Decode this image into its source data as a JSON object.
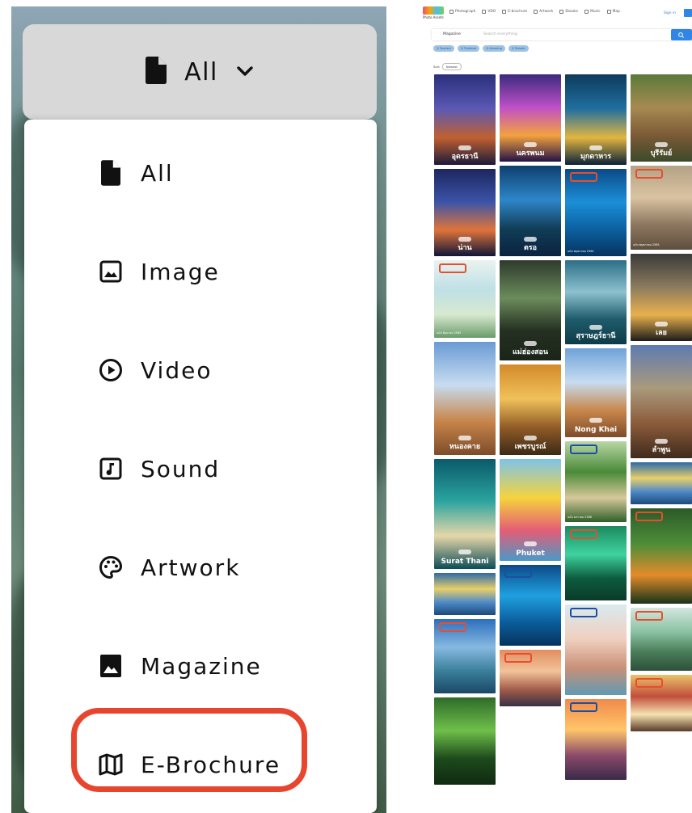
{
  "dropdown": {
    "selected_label": "All",
    "items": [
      {
        "label": "All",
        "icon": "file-icon"
      },
      {
        "label": "Image",
        "icon": "image-icon"
      },
      {
        "label": "Video",
        "icon": "play-circle-icon"
      },
      {
        "label": "Sound",
        "icon": "music-note-icon"
      },
      {
        "label": "Artwork",
        "icon": "palette-icon"
      },
      {
        "label": "Magazine",
        "icon": "bookmark-image-icon"
      },
      {
        "label": "E-Brochure",
        "icon": "map-icon"
      }
    ],
    "highlighted_item": "E-Brochure",
    "highlight_color": "#e8452f"
  },
  "site": {
    "logo_caption": "Photo Assets",
    "nav": [
      "Photograph",
      "VDO",
      "E-brochure",
      "Artwork",
      "Ebooks",
      "Music",
      "Map"
    ],
    "sign_in": "Sign in",
    "search": {
      "type_select": "Magazine",
      "placeholder": "Search everything"
    },
    "chips": [
      "Q Tourism",
      "Q Thailand",
      "Q Amazing",
      "Q Temple"
    ],
    "sort": {
      "label": "Sort",
      "value": "Newest"
    },
    "cards": [
      {
        "col": 0,
        "title": "อุดรธานี",
        "kind": "amazing",
        "colors": [
          "#2a2f7a",
          "#5b59b5",
          "#c06030",
          "#1b1a3a"
        ]
      },
      {
        "col": 1,
        "title": "นครพนม",
        "kind": "amazing",
        "colors": [
          "#3b2b7e",
          "#c050c8",
          "#f3a23e",
          "#231246"
        ]
      },
      {
        "col": 2,
        "title": "มุกดาหาร",
        "kind": "amazing",
        "colors": [
          "#0e3a5a",
          "#1f6fa0",
          "#e1b540",
          "#0a2239"
        ]
      },
      {
        "col": 3,
        "title": "บุรีรัมย์",
        "kind": "amazing",
        "colors": [
          "#5a7a3a",
          "#a68a52",
          "#7b5a36",
          "#3b4a2a"
        ]
      },
      {
        "col": 0,
        "title": "น่าน",
        "kind": "amazing",
        "colors": [
          "#1d2660",
          "#3b54a8",
          "#e0743a",
          "#101538"
        ]
      },
      {
        "col": 1,
        "title": "ตรอ",
        "kind": "amazing",
        "colors": [
          "#0e3f6f",
          "#2d86c8",
          "#113d56",
          "#0a2240"
        ]
      },
      {
        "col": 2,
        "title": "",
        "kind": "osan",
        "foot": "ฉบับ พฤษภาคม 2564",
        "colors": [
          "#0b4a86",
          "#1b8fd8",
          "#0b5f9e",
          "#06335e"
        ]
      },
      {
        "col": 3,
        "title": "",
        "kind": "osan",
        "foot": "ฉบับ พฤษภาคม 2565",
        "colors": [
          "#b4a285",
          "#d9c3a2",
          "#8d7760",
          "#5f4f3e"
        ]
      },
      {
        "col": 0,
        "title": "",
        "kind": "osan-green",
        "foot": "ฉบับ มิถุนายน 2565",
        "colors": [
          "#e9f3f0",
          "#bfe0e6",
          "#d7e9cf",
          "#6a9b6a"
        ]
      },
      {
        "col": 1,
        "title": "แม่ฮ่องสอน",
        "kind": "amazing",
        "colors": [
          "#2e3a2c",
          "#6b8c5c",
          "#253022",
          "#1a2418"
        ]
      },
      {
        "col": 2,
        "title": "สุราษฎร์ธานี",
        "kind": "amazing",
        "colors": [
          "#2c6f87",
          "#8dc1cf",
          "#1f5c6b",
          "#0e3b48"
        ]
      },
      {
        "col": 3,
        "title": "เลย",
        "kind": "amazing",
        "colors": [
          "#3a3a38",
          "#8b7b5f",
          "#e8b04d",
          "#1c1c1a"
        ]
      },
      {
        "col": 0,
        "title": "หนองคาย",
        "kind": "amazing",
        "colors": [
          "#6a9bd4",
          "#c7dcf1",
          "#c8864a",
          "#7d4c2a"
        ]
      },
      {
        "col": 1,
        "title": "เพชรบูรณ์",
        "kind": "amazing",
        "colors": [
          "#d38a2b",
          "#f0c15a",
          "#8f5a26",
          "#3b2a16"
        ]
      },
      {
        "col": 2,
        "title": "Nong Khai",
        "kind": "amazing-new",
        "colors": [
          "#6ea3d8",
          "#c7dcf1",
          "#c8864a",
          "#7d4c2a"
        ]
      },
      {
        "col": 3,
        "title": "ลำพูน",
        "kind": "amazing",
        "colors": [
          "#5e7bb0",
          "#a99a7c",
          "#8a5a3a",
          "#3f2b1c"
        ]
      },
      {
        "col": 0,
        "title": "Surat Thani",
        "kind": "amazing-new",
        "colors": [
          "#0b5a6a",
          "#2aa39f",
          "#e5d7a8",
          "#0d4c58"
        ]
      },
      {
        "col": 1,
        "title": "Phuket",
        "kind": "amazing-new",
        "colors": [
          "#7ec3e8",
          "#f5d43d",
          "#e45d76",
          "#4a99c7"
        ]
      },
      {
        "col": 2,
        "title": "",
        "kind": "osan-blue",
        "foot": "ฉบับ มกราคม 2566",
        "colors": [
          "#b9d7a4",
          "#4a8a3a",
          "#d6c89a",
          "#2f5f2a"
        ]
      },
      {
        "col": 3,
        "title": "",
        "kind": "royal",
        "colors": [
          "#2d6aa8",
          "#e8cf6a",
          "#4d8ac8",
          "#1c4a7b"
        ]
      },
      {
        "col": 0,
        "title": "",
        "kind": "royal",
        "colors": [
          "#2d6aa8",
          "#e8cf6a",
          "#4d8ac8",
          "#1c4a7b"
        ]
      },
      {
        "col": 3,
        "title": "",
        "kind": "osan",
        "foot": "",
        "colors": [
          "#2a5a2a",
          "#4f8e38",
          "#e38b2a",
          "#17331a"
        ]
      },
      {
        "col": 2,
        "title": "",
        "kind": "osan-green",
        "foot": "",
        "colors": [
          "#1b8a5e",
          "#3fd2a0",
          "#0d5c3f",
          "#0a3b28"
        ]
      },
      {
        "col": 1,
        "title": "",
        "kind": "osan-blue",
        "foot": "",
        "colors": [
          "#0b4a86",
          "#1fa0e0",
          "#0b5f9e",
          "#06335e"
        ]
      },
      {
        "col": 3,
        "title": "",
        "kind": "osan-green",
        "foot": "",
        "colors": [
          "#d3e7df",
          "#8bc2a3",
          "#4a7e5a",
          "#2e4f3a"
        ]
      },
      {
        "col": 0,
        "title": "",
        "kind": "osan",
        "foot": "",
        "colors": [
          "#2b6fbd",
          "#87b9e0",
          "#3a7f9a",
          "#1a4866"
        ]
      },
      {
        "col": 2,
        "title": "",
        "kind": "osan-blue",
        "foot": "",
        "colors": [
          "#d9eaf0",
          "#f0d0c0",
          "#c99078",
          "#5f9ab3"
        ]
      },
      {
        "col": 1,
        "title": "",
        "kind": "osan",
        "foot": "",
        "colors": [
          "#e28d5f",
          "#f2c39a",
          "#a35d4a",
          "#3a2e45"
        ]
      },
      {
        "col": 3,
        "title": "",
        "kind": "osan",
        "foot": "",
        "colors": [
          "#e9c46a",
          "#c24e3b",
          "#f4e3b0",
          "#5a3a28"
        ]
      },
      {
        "col": 2,
        "title": "",
        "kind": "osan-blue",
        "foot": "",
        "colors": [
          "#f08a4a",
          "#ffc56a",
          "#8a4a6a",
          "#3a2a4a"
        ]
      },
      {
        "col": 0,
        "title": "",
        "kind": "plain",
        "colors": [
          "#2f6b2a",
          "#6fbf4a",
          "#1d4a1c",
          "#102a10"
        ]
      }
    ]
  }
}
